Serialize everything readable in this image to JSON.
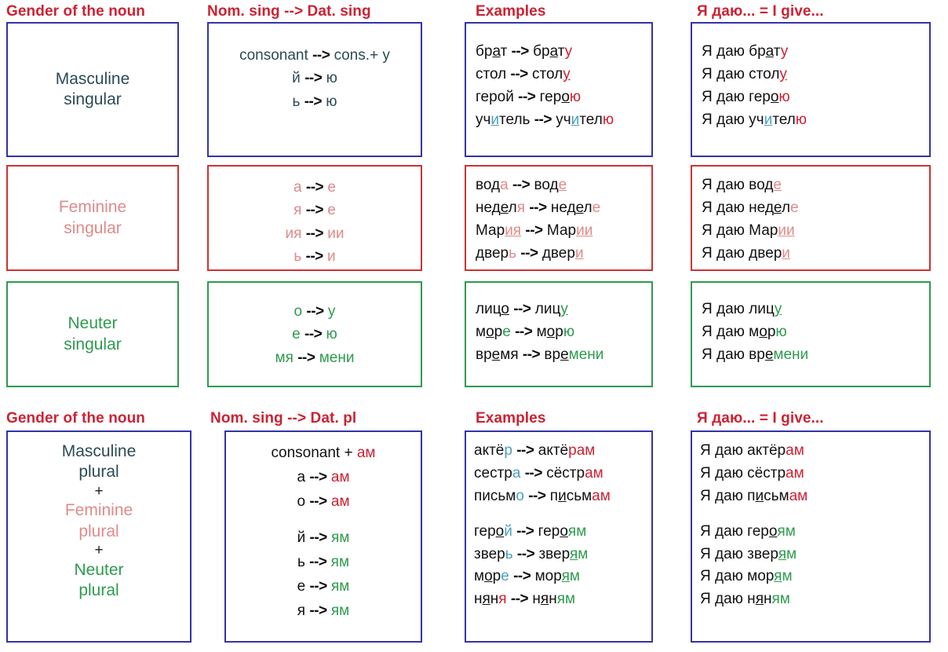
{
  "section_singular": {
    "headers": [
      {
        "id": "gender-of-the-noun",
        "label": "Gender of the noun"
      },
      {
        "id": "nom-to-dat-sing",
        "label": "Nom. sing  -->   Dat. sing"
      },
      {
        "id": "examples",
        "label": "Examples"
      },
      {
        "id": "ya-dayu",
        "label": "Я даю... = I give..."
      }
    ],
    "rows": [
      {
        "gender": "Masculine singular",
        "gender_lines": [
          "Masculine",
          "singular"
        ],
        "color": "#3333aa",
        "rules": [
          "consonant --> cons.+ у",
          "й --> ю",
          "ь --> ю"
        ],
        "examples": [
          "брат --> брату",
          "стол --> столу",
          "герой --> герою",
          "учитель --> учителю"
        ],
        "give": [
          "Я даю брату",
          "Я даю столу",
          "Я даю герою",
          "Я даю учителю"
        ]
      },
      {
        "gender": "Feminine singular",
        "gender_lines": [
          "Feminine",
          "singular"
        ],
        "color": "#cc3333",
        "rules": [
          "а --> е",
          "я --> е",
          "ия --> ии",
          "ь --> и"
        ],
        "examples": [
          "вода --> воде",
          "неделя --> неделе",
          "Мария --> Марии",
          "дверь --> двери"
        ],
        "give": [
          "Я даю воде",
          "Я даю неделе",
          "Я даю Марии",
          "Я даю двери"
        ]
      },
      {
        "gender": "Neuter singular",
        "gender_lines": [
          "Neuter",
          "singular"
        ],
        "color": "#2e9b4f",
        "rules": [
          "о --> у",
          "е --> ю",
          "мя --> мени"
        ],
        "examples": [
          "лицо --> лицу",
          "море --> морю",
          "время --> времени"
        ],
        "give": [
          "Я даю лицу",
          "Я даю морю",
          "Я даю времени"
        ]
      }
    ]
  },
  "section_plural": {
    "headers": [
      {
        "id": "gender-of-the-noun",
        "label": "Gender of the noun"
      },
      {
        "id": "nom-to-dat-pl",
        "label": "Nom. sing   -->   Dat. pl"
      },
      {
        "id": "examples",
        "label": "Examples"
      },
      {
        "id": "ya-dayu",
        "label": "Я даю... = I give..."
      }
    ],
    "gender_lines": [
      "Masculine",
      "plural",
      "+",
      "Feminine",
      "plural",
      "+",
      "Neuter",
      "plural"
    ],
    "rules": [
      "consonant + ам",
      "а --> ам",
      "о --> ам",
      "",
      "й --> ям",
      "ь --> ям",
      "е --> ям",
      "я --> ям"
    ],
    "examples": [
      "актёр --> актёрам",
      "сестра --> сёстрам",
      "письмо --> письмам",
      "",
      "герой --> героям",
      "зверь --> зверям",
      "море  --> морям",
      "няня  --> няням"
    ],
    "give": [
      "Я даю актёрам",
      "Я даю  сёстрам",
      "Я даю письмам",
      "",
      "Я даю героям",
      "Я даю зверям",
      "Я даю морям",
      "Я даю няням"
    ]
  },
  "colors": {
    "header_red": "#cc2233",
    "masculine_blue": "#3333aa",
    "masculine_text": "#2d4a55",
    "feminine_red": "#cc3333",
    "feminine_text": "#e08a8a",
    "neuter_green": "#2e9b4f",
    "ending_red": "#cc2233",
    "ending_green": "#2e9b4f",
    "stress_blue": "#4a9ec4"
  }
}
